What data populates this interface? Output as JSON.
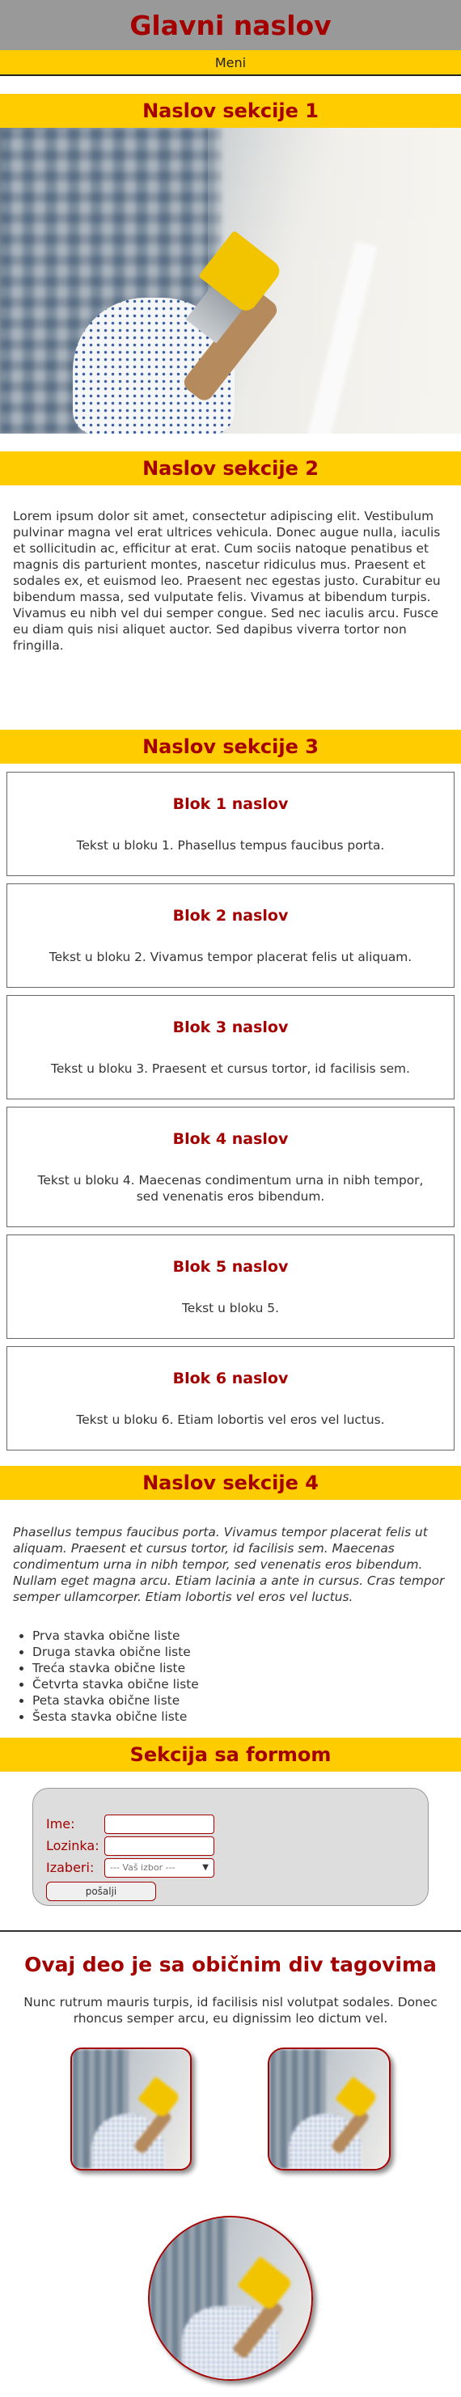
{
  "header": {
    "title": "Glavni naslov",
    "menu": "Meni"
  },
  "section1": {
    "title": "Naslov sekcije 1"
  },
  "section2": {
    "title": "Naslov sekcije 2",
    "text": "Lorem ipsum dolor sit amet, consectetur adipiscing elit. Vestibulum pulvinar magna vel erat ultrices vehicula. Donec augue nulla, iaculis et sollicitudin ac, efficitur at erat. Cum sociis natoque penatibus et magnis dis parturient montes, nascetur ridiculus mus. Praesent et sodales ex, et euismod leo. Praesent nec egestas justo. Curabitur eu bibendum massa, sed vulputate felis. Vivamus at bibendum turpis. Vivamus eu nibh vel dui semper congue. Sed nec iaculis arcu. Fusce eu diam quis nisi aliquet auctor. Sed dapibus viverra tortor non fringilla."
  },
  "section3": {
    "title": "Naslov sekcije 3",
    "blocks": [
      {
        "title": "Blok 1 naslov",
        "text": "Tekst u bloku 1. Phasellus tempus faucibus porta."
      },
      {
        "title": "Blok 2 naslov",
        "text": "Tekst u bloku 2. Vivamus tempor placerat felis ut aliquam."
      },
      {
        "title": "Blok 3 naslov",
        "text": "Tekst u bloku 3. Praesent et cursus tortor, id facilisis sem."
      },
      {
        "title": "Blok 4 naslov",
        "text": "Tekst u bloku 4. Maecenas condimentum urna in nibh tempor, sed venenatis eros bibendum."
      },
      {
        "title": "Blok 5 naslov",
        "text": "Tekst u bloku 5."
      },
      {
        "title": "Blok 6 naslov",
        "text": "Tekst u bloku 6. Etiam lobortis vel eros vel luctus."
      }
    ]
  },
  "section4": {
    "title": "Naslov sekcije 4",
    "italic_text": "Phasellus tempus faucibus porta. Vivamus tempor placerat felis ut aliquam. Praesent et cursus tortor, id facilisis sem. Maecenas condimentum urna in nibh tempor, sed venenatis eros bibendum. Nullam eget magna arcu. Etiam lacinia a ante in cursus. Cras tempor semper ullamcorper. Etiam lobortis vel eros vel luctus.",
    "list": [
      "Prva stavka obične liste",
      "Druga stavka obične liste",
      "Treća stavka obične liste",
      "Četvrta stavka obične liste",
      "Peta stavka obične liste",
      "Šesta stavka obične liste"
    ]
  },
  "form_section": {
    "title": "Sekcija sa formom",
    "name_label": "Ime:",
    "password_label": "Lozinka:",
    "select_label": "Izaberi:",
    "select_value": "--- Vaš izbor ---",
    "submit_label": "pošalji"
  },
  "div_section": {
    "title": "Ovaj deo je sa običnim div tagovima",
    "text": "Nunc rutrum mauris turpis, id facilisis nisl volutpat sodales. Donec rhoncus semper arcu, eu dignissim leo dictum vel."
  },
  "colors": {
    "accent_red": "#a40000",
    "yellow": "#ffcc00",
    "header_gray": "#999999"
  }
}
